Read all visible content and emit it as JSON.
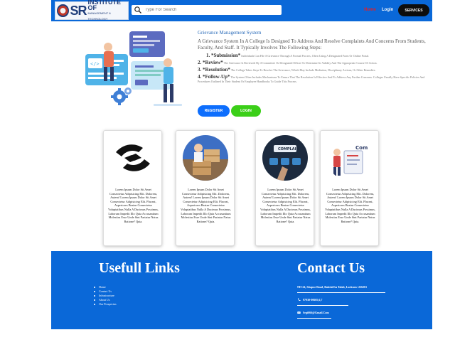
{
  "header": {
    "logo_brand": "SR",
    "logo_name": "INSTITUTE OF",
    "logo_sub": "MANAGEMENT & TECHNOLOGY",
    "search_placeholder": "Type For Search",
    "nav_home": "Home",
    "nav_login": "Login",
    "services_label": "SERVICES"
  },
  "intro": {
    "title": "Grievance Management System",
    "description": "A Grievance System In A College Is Designed To Address And Resolve Complaints And Concerns From Students, Faculty, And Staff. It Typically Involves The Following Steps:",
    "steps": [
      {
        "head": "1. *Submission*",
        "text": "Individuals Can File A Grievance Through A Formal Process, Often Using A Designated Form Or Online Portal."
      },
      {
        "head": "2. *Review*",
        "text": "The Grievance Is Reviewed By A Committee Or Designated Officer To Determine Its Validity And The Appropriate Course Of Action."
      },
      {
        "head": "3. *Resolution*",
        "text": "The College Takes Steps To Resolve The Grievance, Which May Include Mediation, Disciplinary Actions, Or Other Remedies."
      },
      {
        "head": "4. *Follow-Up*",
        "text": "The System Often Includes Mechanisms To Ensure That The Resolution Is Effective And To Address Any Further Concerns. Colleges Usually Have Specific Policies And Procedures Outlined In Their Student Or Employee Handbooks To Guide This Process."
      }
    ],
    "register_label": "REGISTER",
    "login_label": "LOGIN"
  },
  "cards": [
    {
      "text": "Lorem Ipsum Dolor Sit Amet Consectetur Adipisicing Elit. Dolorem, Autem! Lorem Ipsum Dolor Sit Amet Consectetur Adipisicing Elit. Placeat, Asperiores Beatae Consectetur Voluptatibus Nulla A Ducimus Possimus, Laborum Impedit Illo Quia Accusantium Molestias Esse Unde Sint Pariatur Natus Ratione? Quia."
    },
    {
      "text": "Lorem Ipsum Dolor Sit Amet Consectetur Adipisicing Elit. Dolorem, Autem! Lorem Ipsum Dolor Sit Amet Consectetur Adipisicing Elit. Placeat, Asperiores Beatae Consectetur Voluptatibus Nulla A Ducimus Possimus, Laborum Impedit Illo Quia Accusantium Molestias Esse Unde Sint Pariatur Natus Ratione? Quia."
    },
    {
      "text": "Lorem Ipsum Dolor Sit Amet Consectetur Adipisicing Elit. Dolorem, Autem! Lorem Ipsum Dolor Sit Amet Consectetur Adipisicing Elit. Placeat, Asperiores Beatae Consectetur Voluptatibus Nulla A Ducimus Possimus, Laborum Impedit Illo Quia Accusantium Molestias Esse Unde Sint Pariatur Natus Ratione? Quia."
    },
    {
      "text": "Lorem Ipsum Dolor Sit Amet Consectetur Adipisicing Elit. Dolorem, Autem! Lorem Ipsum Dolor Sit Amet Consectetur Adipisicing Elit. Placeat, Asperiores Beatae Consectetur Voluptatibus Nulla A Ducimus Possimus, Laborum Impedit Illo Quia Accusantium Molestias Esse Unde Sint Pariatur Natus Ratione? Quia."
    }
  ],
  "footer": {
    "links_title": "Usefull Links",
    "links": [
      "Home",
      "Contact Us",
      "Infrastructure",
      "About Us",
      "Our Prospectus"
    ],
    "contact_title": "Contact Us",
    "address": "NH-24, Sitapur Road, Bakshi Ka Talab, Lucknow-226201",
    "phone": "97930-00605,6,7",
    "email": "Srgi666@Gmail.Com"
  },
  "colors": {
    "brand_blue": "#0a68d8",
    "accent_red": "#e0202a",
    "register_blue": "#0d6efd",
    "login_green": "#3bcf18"
  }
}
